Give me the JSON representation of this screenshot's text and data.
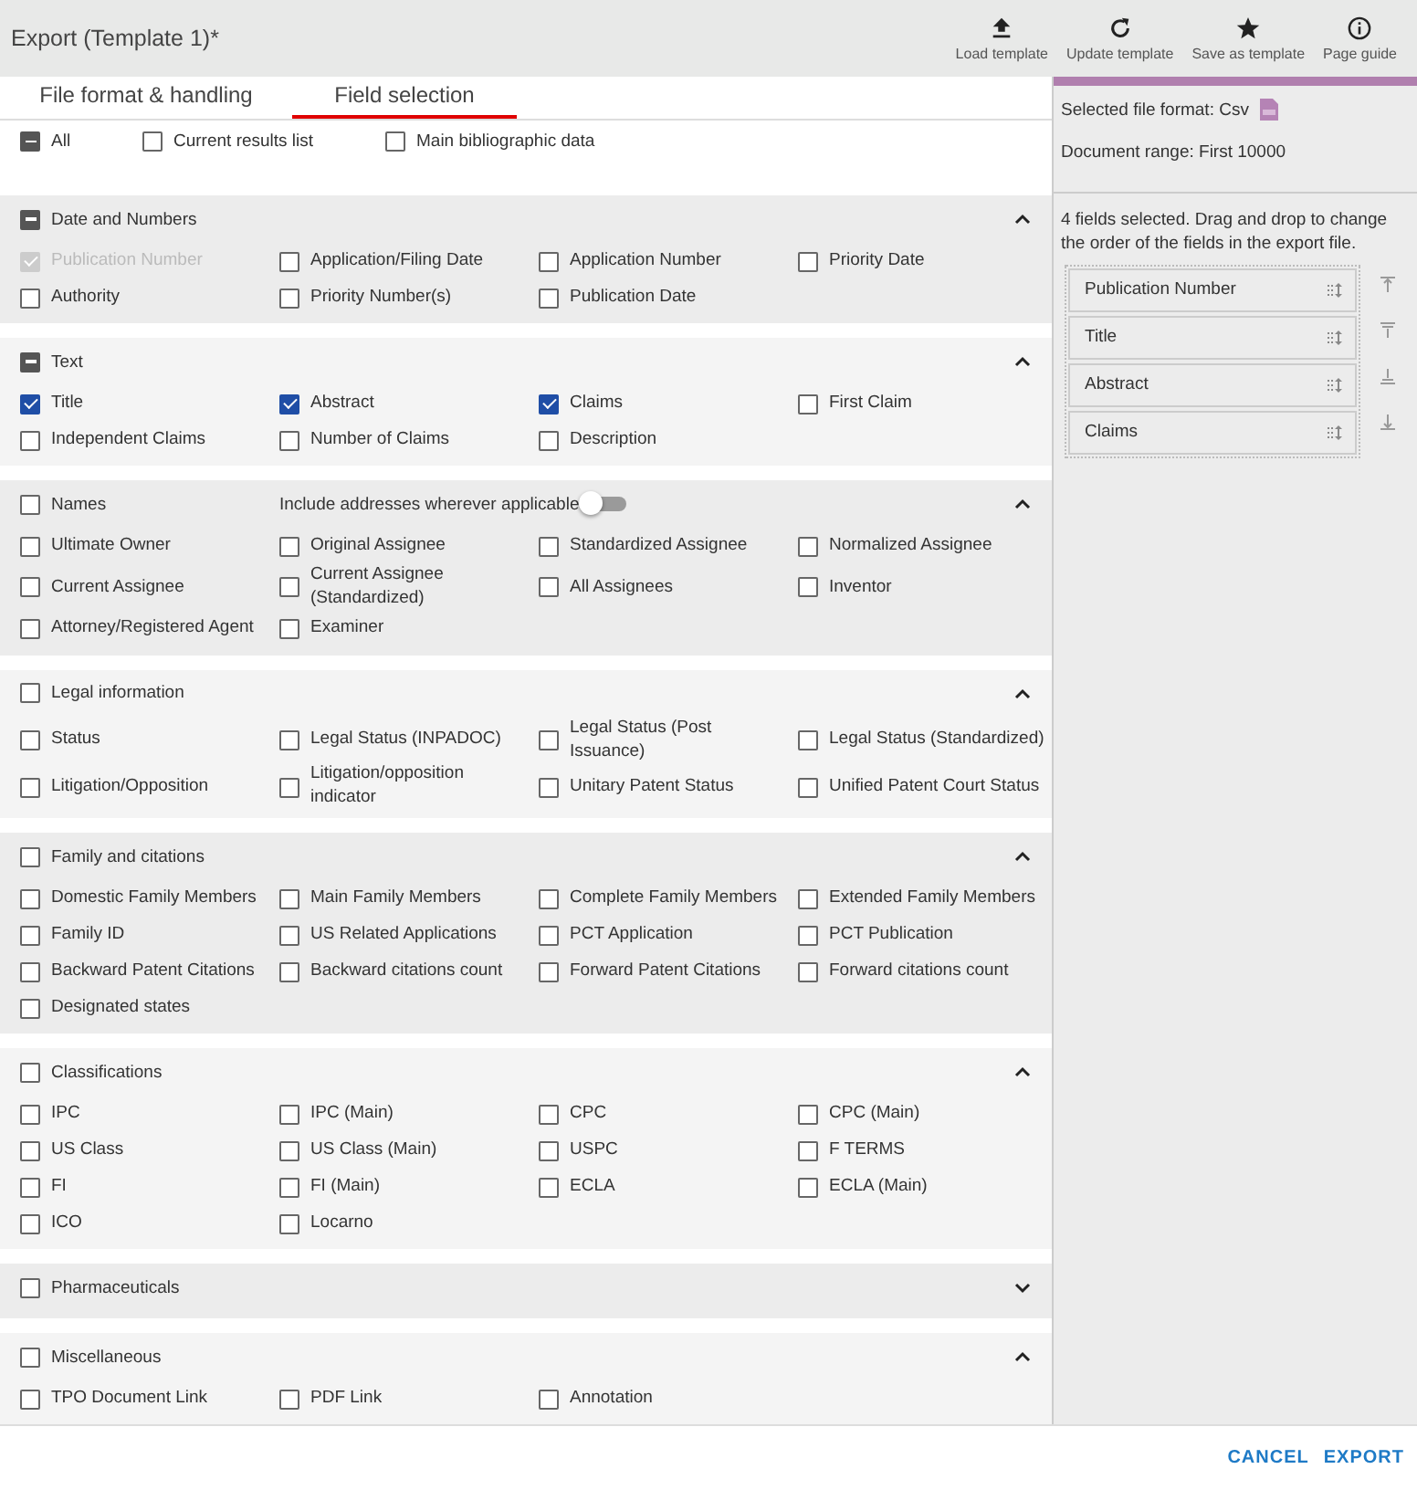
{
  "window": {
    "title": "Export (Template 1)*"
  },
  "toolbar": [
    {
      "kind": "load",
      "label": "Load template"
    },
    {
      "kind": "update",
      "label": "Update template"
    },
    {
      "kind": "save",
      "label": "Save as template"
    },
    {
      "kind": "guide",
      "label": "Page guide"
    }
  ],
  "tabs": [
    {
      "label": "File format & handling",
      "selected": false
    },
    {
      "label": "Field selection",
      "selected": true
    }
  ],
  "quick_select": [
    {
      "label": "All",
      "indeterminate": true
    },
    {
      "label": "Current results list",
      "indeterminate": false
    },
    {
      "label": "Main bibliographic data",
      "indeterminate": false
    }
  ],
  "sections": [
    {
      "title": "Date and Numbers",
      "indeterminate": true,
      "expanded": true,
      "fields": [
        {
          "label": "Publication Number",
          "checked": true,
          "disabled": true
        },
        {
          "label": "Application/Filing Date",
          "checked": false,
          "disabled": false
        },
        {
          "label": "Application Number",
          "checked": false,
          "disabled": false
        },
        {
          "label": "Priority Date",
          "checked": false,
          "disabled": false
        },
        {
          "label": "Authority",
          "checked": false,
          "disabled": false
        },
        {
          "label": "Priority Number(s)",
          "checked": false,
          "disabled": false
        },
        {
          "label": "Publication Date",
          "checked": false,
          "disabled": false
        }
      ]
    },
    {
      "title": "Text",
      "indeterminate": true,
      "expanded": true,
      "fields": [
        {
          "label": "Title",
          "checked": true,
          "disabled": false
        },
        {
          "label": "Abstract",
          "checked": true,
          "disabled": false
        },
        {
          "label": "Claims",
          "checked": true,
          "disabled": false
        },
        {
          "label": "First Claim",
          "checked": false,
          "disabled": false
        },
        {
          "label": "Independent Claims",
          "checked": false,
          "disabled": false
        },
        {
          "label": "Number of Claims",
          "checked": false,
          "disabled": false
        },
        {
          "label": "Description",
          "checked": false,
          "disabled": false
        }
      ]
    },
    {
      "title": "Names",
      "indeterminate": false,
      "expanded": true,
      "toggle": {
        "label": "Include addresses wherever applicable",
        "on": false
      },
      "fields": [
        {
          "label": "Ultimate Owner",
          "checked": false,
          "disabled": false
        },
        {
          "label": "Original Assignee",
          "checked": false,
          "disabled": false
        },
        {
          "label": "Standardized Assignee",
          "checked": false,
          "disabled": false
        },
        {
          "label": "Normalized Assignee",
          "checked": false,
          "disabled": false
        },
        {
          "label": "Current Assignee",
          "checked": false,
          "disabled": false
        },
        {
          "label": "Current Assignee (Standardized)",
          "checked": false,
          "disabled": false
        },
        {
          "label": "All Assignees",
          "checked": false,
          "disabled": false
        },
        {
          "label": "Inventor",
          "checked": false,
          "disabled": false
        },
        {
          "label": "Attorney/Registered Agent",
          "checked": false,
          "disabled": false
        },
        {
          "label": "Examiner",
          "checked": false,
          "disabled": false
        }
      ]
    },
    {
      "title": "Legal information",
      "indeterminate": false,
      "expanded": true,
      "fields": [
        {
          "label": "Status",
          "checked": false,
          "disabled": false
        },
        {
          "label": "Legal Status (INPADOC)",
          "checked": false,
          "disabled": false
        },
        {
          "label": "Legal Status (Post Issuance)",
          "checked": false,
          "disabled": false
        },
        {
          "label": "Legal Status (Standardized)",
          "checked": false,
          "disabled": false
        },
        {
          "label": "Litigation/Opposition",
          "checked": false,
          "disabled": false
        },
        {
          "label": "Litigation/opposition indicator",
          "checked": false,
          "disabled": false
        },
        {
          "label": "Unitary Patent Status",
          "checked": false,
          "disabled": false
        },
        {
          "label": "Unified Patent Court Status",
          "checked": false,
          "disabled": false
        }
      ]
    },
    {
      "title": "Family and citations",
      "indeterminate": false,
      "expanded": true,
      "fields": [
        {
          "label": "Domestic Family Members",
          "checked": false,
          "disabled": false
        },
        {
          "label": "Main Family Members",
          "checked": false,
          "disabled": false
        },
        {
          "label": "Complete Family Members",
          "checked": false,
          "disabled": false
        },
        {
          "label": "Extended Family Members",
          "checked": false,
          "disabled": false
        },
        {
          "label": "Family ID",
          "checked": false,
          "disabled": false
        },
        {
          "label": "US Related Applications",
          "checked": false,
          "disabled": false
        },
        {
          "label": "PCT Application",
          "checked": false,
          "disabled": false
        },
        {
          "label": "PCT Publication",
          "checked": false,
          "disabled": false
        },
        {
          "label": "Backward Patent Citations",
          "checked": false,
          "disabled": false
        },
        {
          "label": "Backward citations count",
          "checked": false,
          "disabled": false
        },
        {
          "label": "Forward Patent Citations",
          "checked": false,
          "disabled": false
        },
        {
          "label": "Forward citations count",
          "checked": false,
          "disabled": false
        },
        {
          "label": "Designated states",
          "checked": false,
          "disabled": false
        }
      ]
    },
    {
      "title": "Classifications",
      "indeterminate": false,
      "expanded": true,
      "fields": [
        {
          "label": "IPC",
          "checked": false,
          "disabled": false
        },
        {
          "label": "IPC (Main)",
          "checked": false,
          "disabled": false
        },
        {
          "label": "CPC",
          "checked": false,
          "disabled": false
        },
        {
          "label": "CPC (Main)",
          "checked": false,
          "disabled": false
        },
        {
          "label": "US Class",
          "checked": false,
          "disabled": false
        },
        {
          "label": "US Class (Main)",
          "checked": false,
          "disabled": false
        },
        {
          "label": "USPC",
          "checked": false,
          "disabled": false
        },
        {
          "label": "F TERMS",
          "checked": false,
          "disabled": false
        },
        {
          "label": "FI",
          "checked": false,
          "disabled": false
        },
        {
          "label": "FI (Main)",
          "checked": false,
          "disabled": false
        },
        {
          "label": "ECLA",
          "checked": false,
          "disabled": false
        },
        {
          "label": "ECLA (Main)",
          "checked": false,
          "disabled": false
        },
        {
          "label": "ICO",
          "checked": false,
          "disabled": false
        },
        {
          "label": "Locarno",
          "checked": false,
          "disabled": false
        }
      ]
    },
    {
      "title": "Pharmaceuticals",
      "indeterminate": false,
      "expanded": false
    },
    {
      "title": "Miscellaneous",
      "indeterminate": false,
      "expanded": true,
      "fields": [
        {
          "label": "TPO Document Link",
          "checked": false,
          "disabled": false
        },
        {
          "label": "PDF Link",
          "checked": false,
          "disabled": false
        },
        {
          "label": "Annotation",
          "checked": false,
          "disabled": false
        }
      ]
    }
  ],
  "summary": {
    "file_format": "Selected file format: Csv",
    "document_range": "Document range: First 10000",
    "hint": "4 fields selected. Drag and drop to change the order of the fields in the export file.",
    "selected_fields": [
      "Publication Number",
      "Title",
      "Abstract",
      "Claims"
    ]
  },
  "buttons": [
    {
      "label": "CANCEL"
    },
    {
      "label": "EXPORT"
    }
  ]
}
